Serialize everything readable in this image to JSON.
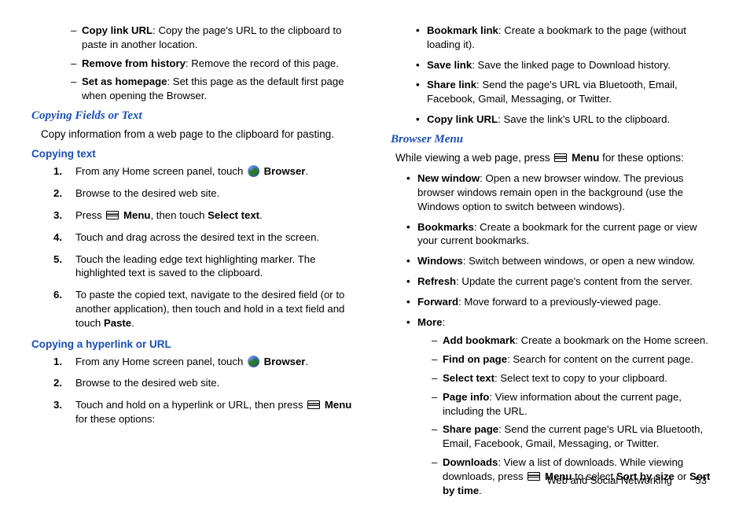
{
  "left": {
    "dash_top": [
      {
        "bold": "Copy link URL",
        "text": ": Copy the page's URL to the clipboard to paste in another location."
      },
      {
        "bold": "Remove from history",
        "text": ": Remove the record of this page."
      },
      {
        "bold": "Set as homepage",
        "text": ": Set this page as the default first page when opening the Browser."
      }
    ],
    "h1": "Copying Fields or Text",
    "intro": "Copy information from a web page to the clipboard for pasting.",
    "h2a": "Copying text",
    "steps_a": {
      "s1_pre": "From any Home screen panel, touch ",
      "s1_bold": "Browser",
      "s1_post": ".",
      "s2": "Browse to the desired web site.",
      "s3_pre": "Press ",
      "s3_b1": "Menu",
      "s3_mid": ", then touch ",
      "s3_b2": "Select text",
      "s3_post": ".",
      "s4": "Touch and drag across the desired text in the screen.",
      "s5": "Touch the leading edge text highlighting marker. The highlighted text is saved to the clipboard.",
      "s6_pre": "To paste the copied text, navigate to the desired field (or to another application), then touch and hold in a text field and touch ",
      "s6_bold": "Paste",
      "s6_post": "."
    },
    "h2b": "Copying a hyperlink or URL",
    "steps_b": {
      "s1_pre": "From any Home screen panel, touch ",
      "s1_bold": "Browser",
      "s1_post": ".",
      "s2": "Browse to the desired web site.",
      "s3_pre": "Touch and hold on a hyperlink or URL, then press ",
      "s3_bold": "Menu",
      "s3_post": " for these options:"
    }
  },
  "right": {
    "bullets_top": [
      {
        "bold": "Bookmark link",
        "text": ": Create a bookmark to the page (without loading it)."
      },
      {
        "bold": "Save link",
        "text": ": Save the linked page to Download history."
      },
      {
        "bold": "Share link",
        "text": ": Send the page's URL via Bluetooth, Email, Facebook, Gmail, Messaging, or Twitter."
      },
      {
        "bold": "Copy link URL",
        "text": ": Save the link's URL to the clipboard."
      }
    ],
    "h1": "Browser Menu",
    "intro_pre": "While viewing a web page, press ",
    "intro_bold": "Menu",
    "intro_post": " for these options:",
    "menu": [
      {
        "bold": "New window",
        "text": ": Open a new browser window. The previous browser windows remain open in the background (use the Windows option to switch between windows)."
      },
      {
        "bold": "Bookmarks",
        "text": ": Create a bookmark for the current page or view your current bookmarks."
      },
      {
        "bold": "Windows",
        "text": ": Switch between windows, or open a new window."
      },
      {
        "bold": "Refresh",
        "text": ": Update the current page's content from the server."
      },
      {
        "bold": "Forward",
        "text": ": Move forward to a previously-viewed page."
      }
    ],
    "more_label": "More",
    "more": [
      {
        "bold": "Add bookmark",
        "text": ": Create a bookmark on the Home screen."
      },
      {
        "bold": "Find on page",
        "text": ": Search for content on the current page."
      },
      {
        "bold": "Select text",
        "text": ": Select text to copy to your clipboard."
      },
      {
        "bold": "Page info",
        "text": ": View information about the current page, including the URL."
      },
      {
        "bold": "Share page",
        "text": ": Send the current page's URL via Bluetooth, Email, Facebook, Gmail, Messaging, or Twitter."
      }
    ],
    "downloads": {
      "bold1": "Downloads",
      "text1": ": View a list of downloads. While viewing downloads, press ",
      "bold2": "Menu",
      "text2": " to select ",
      "bold3": "Sort by size",
      "text3": " or ",
      "bold4": "Sort by time",
      "text4": "."
    }
  },
  "footer": {
    "title": "Web and Social Networking",
    "page": "53"
  }
}
